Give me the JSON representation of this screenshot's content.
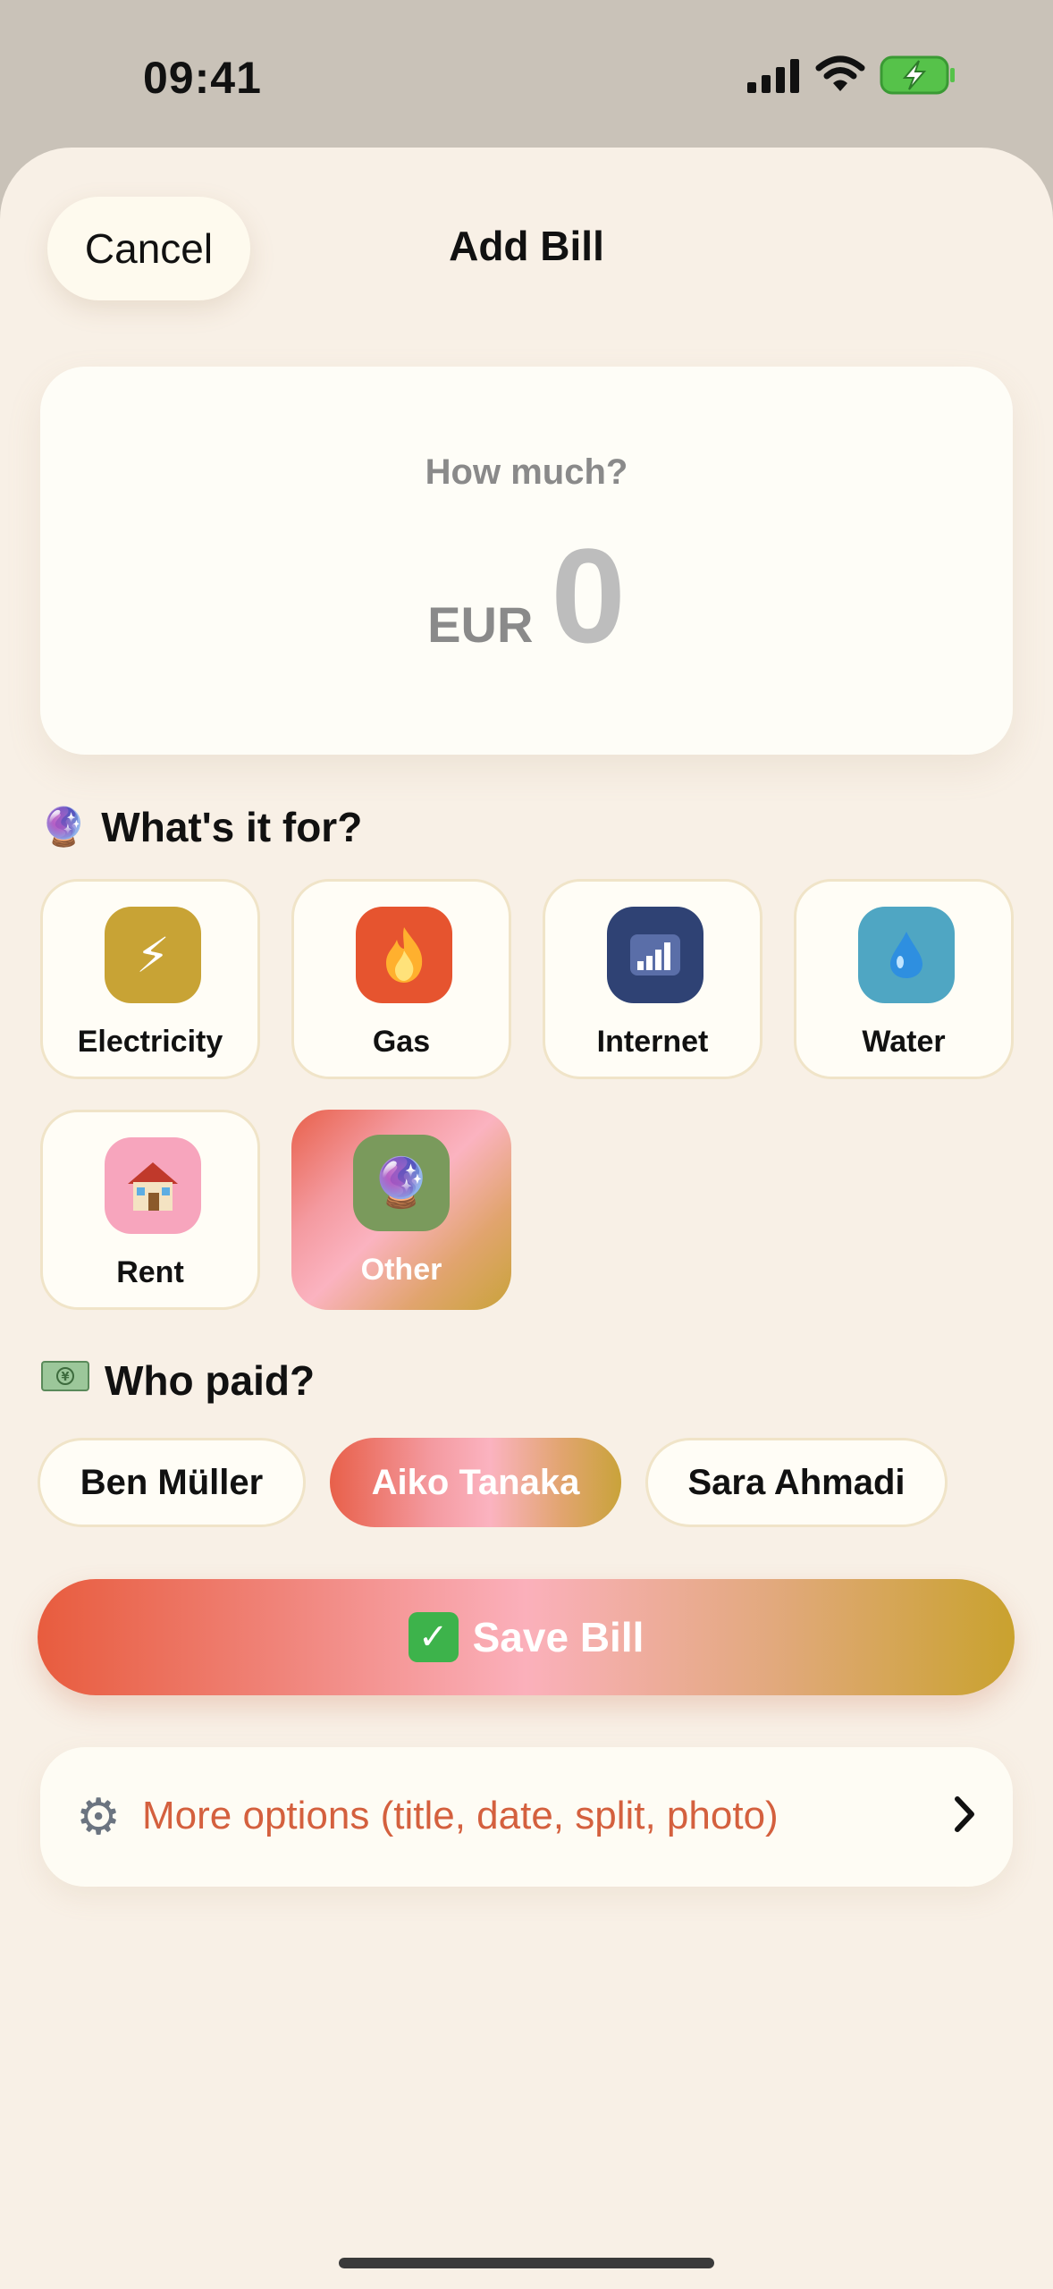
{
  "status_bar": {
    "time": "09:41"
  },
  "header": {
    "cancel_label": "Cancel",
    "title": "Add Bill"
  },
  "amount": {
    "prompt": "How much?",
    "currency": "EUR",
    "value": "0"
  },
  "category_section": {
    "title": "What's it for?",
    "title_icon": "crystal-ball-hand-icon",
    "items": [
      {
        "label": "Electricity",
        "icon": "lightning-icon",
        "color": "#c8a335",
        "selected": false
      },
      {
        "label": "Gas",
        "icon": "fire-icon",
        "color": "#e6542f",
        "selected": false
      },
      {
        "label": "Internet",
        "icon": "signal-bars-icon",
        "color": "#2f4274",
        "selected": false
      },
      {
        "label": "Water",
        "icon": "droplet-icon",
        "color": "#4fa6c3",
        "selected": false
      },
      {
        "label": "Rent",
        "icon": "house-icon",
        "color": "#f7a5bd",
        "selected": false
      },
      {
        "label": "Other",
        "icon": "crystal-ball-icon",
        "color": "#7a9a5c",
        "selected": true
      }
    ]
  },
  "payer_section": {
    "title": "Who paid?",
    "title_icon": "banknote-icon",
    "payers": [
      {
        "label": "Ben Müller",
        "selected": false
      },
      {
        "label": "Aiko Tanaka",
        "selected": true
      },
      {
        "label": "Sara Ahmadi",
        "selected": false
      }
    ]
  },
  "save_button": {
    "label": "Save Bill",
    "icon": "check-box-icon"
  },
  "more_options": {
    "label": "More options (title, date, split, photo)",
    "icon": "gear-icon"
  },
  "colors": {
    "background": "#f8f0e6",
    "accent": "#d4603e",
    "accent_gold": "#c9a22e"
  }
}
